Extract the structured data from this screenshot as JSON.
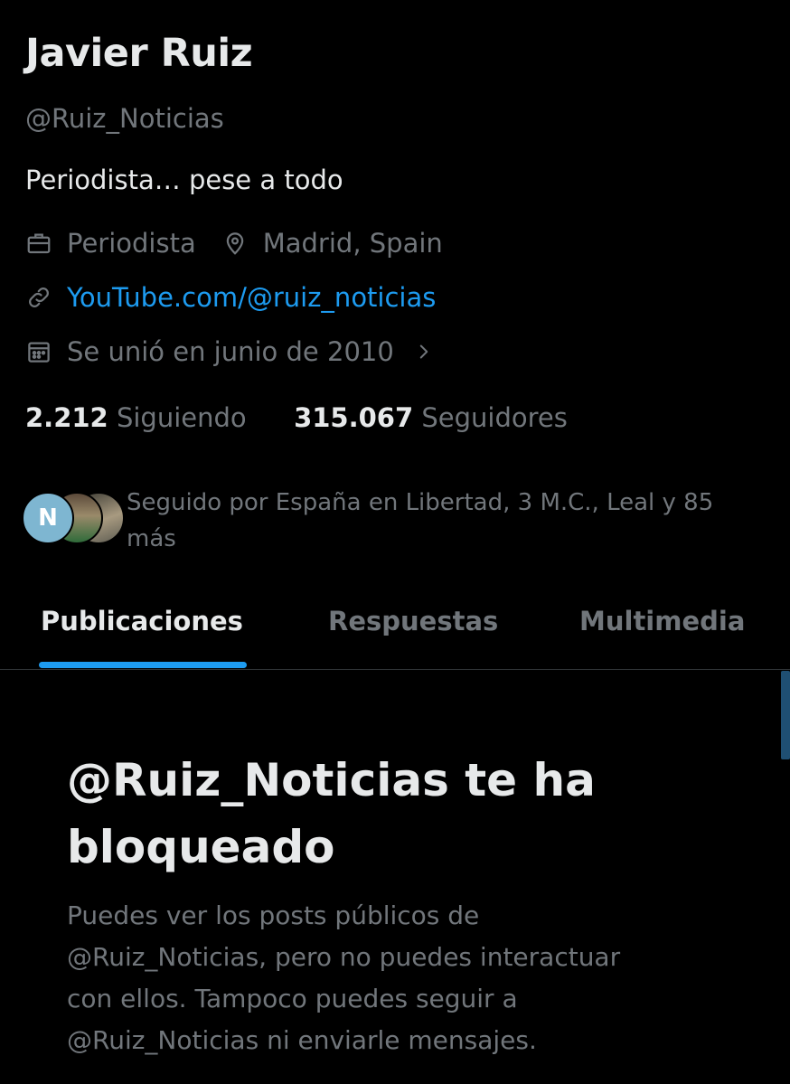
{
  "profile": {
    "name": "Javier Ruiz",
    "handle": "@Ruiz_Noticias",
    "bio": "Periodista… pese a todo",
    "profession": "Periodista",
    "location": "Madrid, Spain",
    "website": "YouTube.com/@ruiz_noticias",
    "joined": "Se unió en junio de 2010"
  },
  "stats": {
    "following_count": "2.212",
    "following_label": "Siguiendo",
    "followers_count": "315.067",
    "followers_label": "Seguidores"
  },
  "followed_by": {
    "text": "Seguido por España en Libertad, 3 M.C., Leal y 85 más",
    "avatar_letter": "N"
  },
  "tabs": [
    {
      "label": "Publicaciones",
      "active": true
    },
    {
      "label": "Respuestas",
      "active": false
    },
    {
      "label": "Multimedia",
      "active": false
    }
  ],
  "blocked": {
    "title": "@Ruiz_Noticias te ha bloqueado",
    "body": "Puedes ver los posts públicos de @Ruiz_Noticias, pero no puedes interactuar con ellos. Tampoco puedes seguir a @Ruiz_Noticias ni enviarle mensajes."
  },
  "colors": {
    "background": "#000000",
    "primary_text": "#e7e9ea",
    "secondary_text": "#71767b",
    "accent": "#1d9bf0"
  },
  "icons": [
    "briefcase-icon",
    "location-pin-icon",
    "link-icon",
    "calendar-icon",
    "chevron-right-icon"
  ]
}
